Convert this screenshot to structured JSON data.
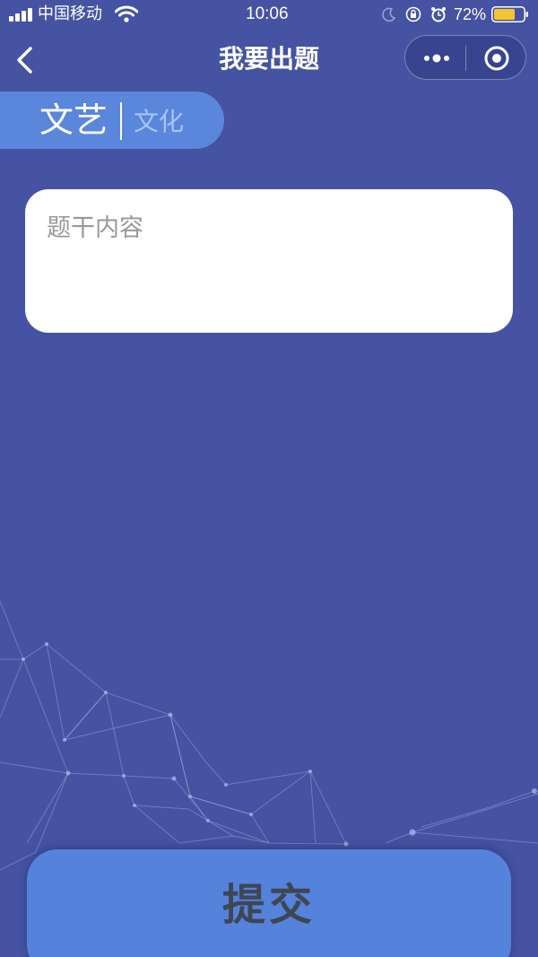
{
  "status_bar": {
    "carrier": "中国移动",
    "time": "10:06",
    "battery_percent": "72%",
    "battery_level": 0.72,
    "icons": [
      "signal-icon",
      "wifi-icon",
      "moon-icon",
      "lock-rotation-icon",
      "alarm-icon",
      "battery-icon"
    ]
  },
  "nav": {
    "title": "我要出题",
    "back_icon": "chevron-left-icon",
    "capsule_icons": [
      "more-icon",
      "close-target-icon"
    ]
  },
  "category": {
    "main": "文艺",
    "sub": "文化"
  },
  "question": {
    "placeholder": "题干内容",
    "value": ""
  },
  "submit": {
    "label": "提交"
  },
  "colors": {
    "background": "#4553a2",
    "accent": "#5582da",
    "pill": "#5a86dc",
    "battery_fill": "#f5c531"
  }
}
